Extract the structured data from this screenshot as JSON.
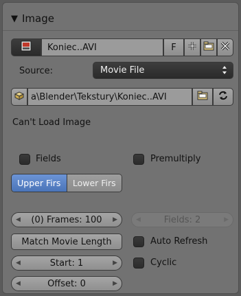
{
  "panel": {
    "title": "Image",
    "collapse_glyph": "▼"
  },
  "image_row": {
    "icon": "image-icon",
    "filename": "Koniec..AVI",
    "fake_user_label": "F",
    "new_icon": "plus-icon",
    "open_icon": "folder-icon",
    "unlink_icon": "x-icon"
  },
  "source": {
    "label": "Source:",
    "value": "Movie File",
    "dropdown_icon": "updown-arrows-icon"
  },
  "filepath": {
    "value": "a\\Blender\\Tekstury\\Koniec..AVI",
    "left_icon": "package-icon",
    "browse_icon": "folder-icon",
    "reload_icon": "reload-icon"
  },
  "status_text": "Can't Load Image",
  "fields_checkbox": {
    "label": "Fields",
    "checked": false
  },
  "premultiply_checkbox": {
    "label": "Premultiply",
    "checked": false
  },
  "field_order": {
    "upper_label": "Upper Firs",
    "lower_label": "Lower Firs",
    "selected": "upper"
  },
  "frames": {
    "label": "(0) Frames: 100"
  },
  "fields_count": {
    "label": "Fields: 2"
  },
  "match_button": {
    "label": "Match Movie Length"
  },
  "auto_refresh": {
    "label": "Auto Refresh",
    "checked": false
  },
  "start": {
    "label": "Start: 1"
  },
  "cyclic": {
    "label": "Cyclic",
    "checked": false
  },
  "offset": {
    "label": "Offset: 0"
  },
  "colors": {
    "panel_bg": "#727272",
    "selected_blue": "#5680c2",
    "checkbox_dark": "#333333"
  }
}
